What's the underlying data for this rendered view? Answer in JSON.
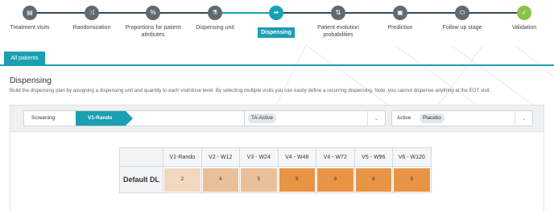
{
  "stepper": {
    "steps": [
      {
        "label_l1": "Treatment visits",
        "label_l2": "",
        "icon": "list-icon",
        "glyph": "▤",
        "state": "done"
      },
      {
        "label_l1": "Randomization",
        "label_l2": "",
        "icon": "shuffle-icon",
        "glyph": "⤨",
        "state": "done"
      },
      {
        "label_l1": "Proportions for patient",
        "label_l2": "attributes",
        "icon": "percent-icon",
        "glyph": "%",
        "state": "done"
      },
      {
        "label_l1": "Dispensing unit",
        "label_l2": "",
        "icon": "flask-icon",
        "glyph": "⚗",
        "state": "done"
      },
      {
        "label_l1": "Dispensing",
        "label_l2": "",
        "icon": "dispense-icon",
        "glyph": "➦",
        "state": "active"
      },
      {
        "label_l1": "Patient evolution",
        "label_l2": "probabilities",
        "icon": "sort-icon",
        "glyph": "⇅",
        "state": "done"
      },
      {
        "label_l1": "Prediction",
        "label_l2": "",
        "icon": "calendar-check-icon",
        "glyph": "▣",
        "state": "done"
      },
      {
        "label_l1": "Follow up stage",
        "label_l2": "",
        "icon": "pill-icon",
        "glyph": "⬭",
        "state": "done"
      },
      {
        "label_l1": "Validation",
        "label_l2": "",
        "icon": "check-circle-icon",
        "glyph": "✓",
        "state": "validation"
      }
    ]
  },
  "tabs": [
    {
      "label": "All patients",
      "active": true
    }
  ],
  "section": {
    "title": "Dispensing",
    "description": "Build the dispensing plan by assigning a dispensing unit and quantity to each visit/dose level. By selecting multiple visits you can easily define a recurring dispensing. Note, you cannot dispense anything at the EOT visit."
  },
  "toolbar": {
    "visit_chips": [
      {
        "label": "Screening",
        "selected": false
      },
      {
        "label": "V1-Rando",
        "selected": true
      }
    ],
    "unit_select": {
      "tags": [
        "TA-Active"
      ],
      "caret": "⌄"
    },
    "quantity_select": {
      "tags": [
        "Active",
        "Placebo"
      ],
      "caret": "⌄"
    }
  },
  "grid": {
    "columns": [
      "V1-Rando",
      "V2 - W12",
      "V3 - W24",
      "V4 - W48",
      "V4 - W72",
      "V5 - W96",
      "V6 - W120"
    ],
    "rows": [
      {
        "label": "Default DL",
        "values": [
          "2",
          "4",
          "5",
          "9",
          "9",
          "9",
          "9"
        ]
      }
    ],
    "colors": {
      "low": "#f1d8bf",
      "mid": "#e9c09a",
      "high": "#e89444"
    }
  },
  "colors": {
    "accent": "#17a2b8",
    "done_step": "#5f6a72",
    "validation_step": "#8bc34a"
  }
}
